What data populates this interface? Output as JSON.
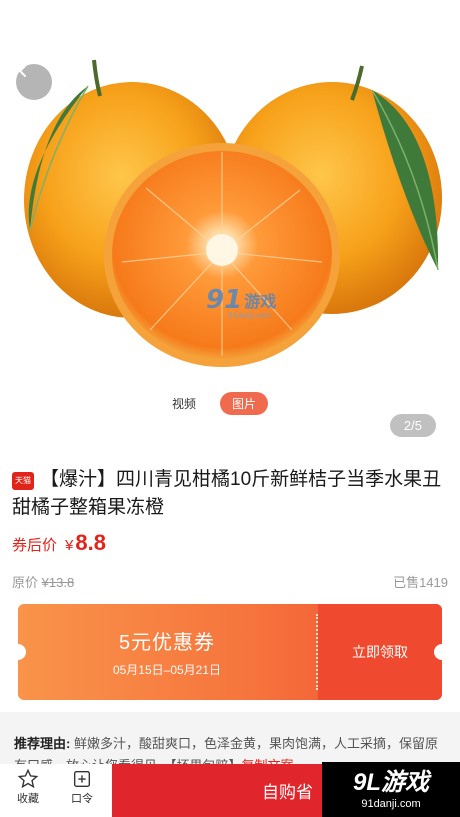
{
  "hero": {
    "media_tabs": [
      {
        "label": "视频",
        "active": false
      },
      {
        "label": "图片",
        "active": true
      }
    ],
    "pager": "2/5",
    "watermark": {
      "brand": "游戏",
      "url": "91danji.com",
      "prefix": "91"
    }
  },
  "product": {
    "store_badge": "天猫",
    "title": "【爆汁】四川青见柑橘10斤新鲜桔子当季水果丑甜橘子整箱果冻橙",
    "price_label": "券后价",
    "currency": "¥",
    "price": "8.8",
    "original_label": "原价",
    "original_price": "¥13.8",
    "sold": "已售1419"
  },
  "coupon": {
    "amount": "5元优惠券",
    "date_range": "05月15日–05月21日",
    "action": "立即领取"
  },
  "recommend": {
    "label": "推荐理由:",
    "text": " 鲜嫩多汁，酸甜爽口，色泽金黄，果肉饱满，人工采摘，保留原有口感，放心让您看得见。【坏果包赔】",
    "link": "复制文案"
  },
  "bottom": {
    "favorite": "收藏",
    "code": "口令",
    "buy": "自购省"
  },
  "bottom_watermark": {
    "brand": "9L游戏",
    "url": "91danji.com"
  },
  "colors": {
    "accent": "#e2231a",
    "coupon_start": "#f9944a",
    "coupon_end": "#f04d2f",
    "orange": "#f59a1e"
  }
}
